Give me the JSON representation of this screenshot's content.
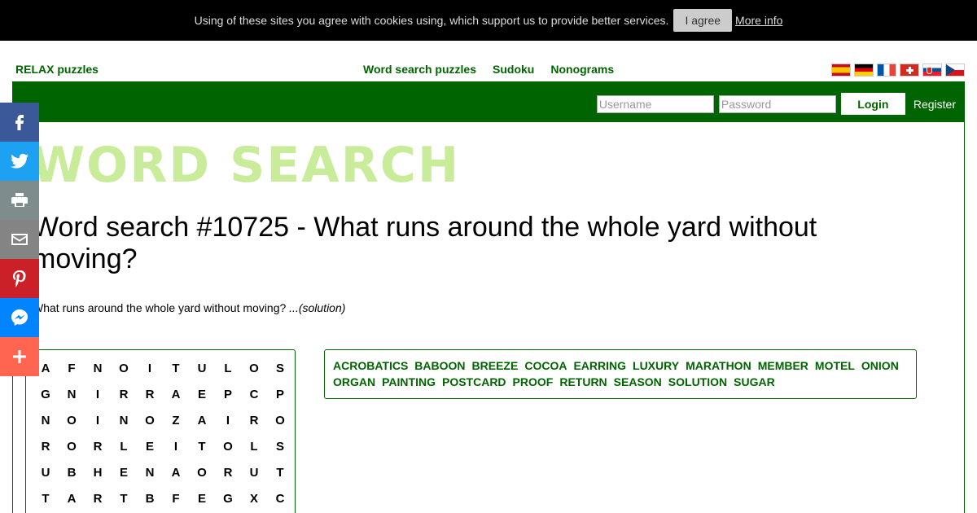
{
  "cookie": {
    "text": "Using of these sites you agree with cookies using, which support us to provide better services.",
    "agree_label": "I agree",
    "more_label": "More info"
  },
  "header": {
    "brand": "RELAX puzzles",
    "nav": [
      "Word search puzzles",
      "Sudoku",
      "Nonograms"
    ],
    "flags": [
      "spain-flag",
      "germany-flag",
      "france-flag",
      "switzerland-flag",
      "slovakia-flag",
      "czech-flag"
    ]
  },
  "login": {
    "username_placeholder": "Username",
    "password_placeholder": "Password",
    "login_label": "Login",
    "register_label": "Register"
  },
  "logo": "WORD SEARCH",
  "title": "Word search #10725 - What runs around the whole yard without moving?",
  "question": "What runs around the whole yard without moving?",
  "solution_label": "...(solution)",
  "grid": [
    [
      "A",
      "F",
      "N",
      "O",
      "I",
      "T",
      "U",
      "L",
      "O",
      "S"
    ],
    [
      "G",
      "N",
      "I",
      "R",
      "R",
      "A",
      "E",
      "P",
      "C",
      "P"
    ],
    [
      "N",
      "O",
      "I",
      "N",
      "O",
      "Z",
      "A",
      "I",
      "R",
      "O"
    ],
    [
      "R",
      "O",
      "R",
      "L",
      "E",
      "I",
      "T",
      "O",
      "L",
      "S"
    ],
    [
      "U",
      "B",
      "H",
      "E",
      "N",
      "A",
      "O",
      "R",
      "U",
      "T"
    ],
    [
      "T",
      "A",
      "R",
      "T",
      "B",
      "F",
      "E",
      "G",
      "X",
      "C"
    ]
  ],
  "words": [
    "ACROBATICS",
    "BABOON",
    "BREEZE",
    "COCOA",
    "EARRING",
    "LUXURY",
    "MARATHON",
    "MEMBER",
    "MOTEL",
    "ONION",
    "ORGAN",
    "PAINTING",
    "POSTCARD",
    "PROOF",
    "RETURN",
    "SEASON",
    "SOLUTION",
    "SUGAR"
  ],
  "share": [
    {
      "name": "facebook",
      "color": "#3b5998"
    },
    {
      "name": "twitter",
      "color": "#1da1f2"
    },
    {
      "name": "print",
      "color": "#7f8c8d"
    },
    {
      "name": "email",
      "color": "#848484"
    },
    {
      "name": "pinterest",
      "color": "#cb2027"
    },
    {
      "name": "messenger",
      "color": "#0084ff"
    },
    {
      "name": "more",
      "color": "#ff6550"
    }
  ],
  "colors": {
    "brand_green": "#006400",
    "logo_green": "#c8ec9a"
  }
}
